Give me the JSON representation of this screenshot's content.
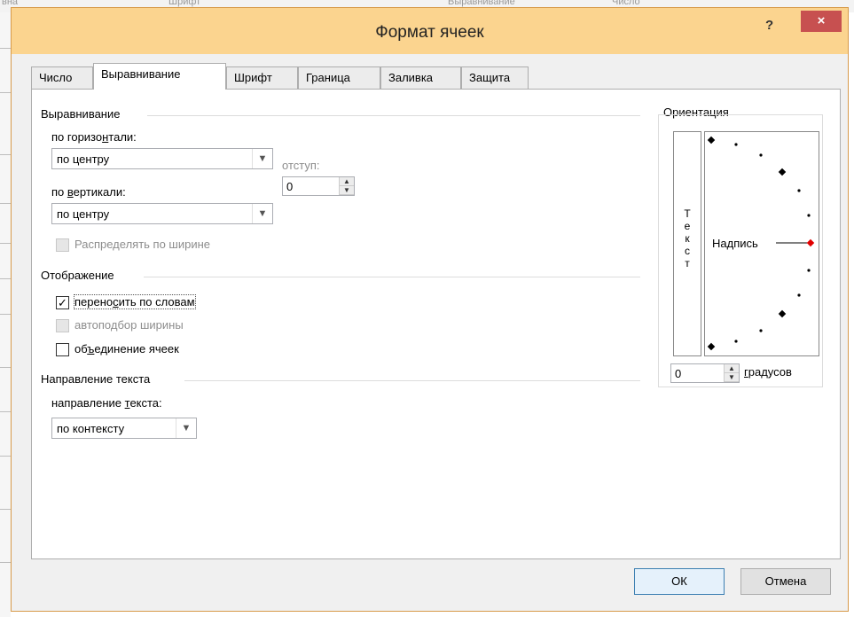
{
  "dialog": {
    "title": "Формат ячеек",
    "help_label": "?",
    "close_label": "×"
  },
  "tabs": [
    {
      "label": "Число"
    },
    {
      "label": "Выравнивание",
      "active": true
    },
    {
      "label": "Шрифт"
    },
    {
      "label": "Граница"
    },
    {
      "label": "Заливка"
    },
    {
      "label": "Защита"
    }
  ],
  "alignment": {
    "section_title": "Выравнивание",
    "horizontal_label_pre": "по горизо",
    "horizontal_label_accel": "н",
    "horizontal_label_post": "тали:",
    "horizontal_value": "по центру",
    "indent_label": "отступ:",
    "indent_value": "0",
    "vertical_label_pre": "по ",
    "vertical_label_accel": "в",
    "vertical_label_post": "ертикали:",
    "vertical_value": "по центру",
    "distribute_label": "Распределять по ширине",
    "distribute_checked": false,
    "distribute_enabled": false
  },
  "display": {
    "section_title": "Отображение",
    "wrap_label_pre": "перено",
    "wrap_label_accel": "с",
    "wrap_label_post": "ить по словам",
    "wrap_checked": true,
    "shrink_label": "автоподбор ширины",
    "shrink_checked": false,
    "shrink_enabled": false,
    "merge_label_pre": "об",
    "merge_label_accel": "ъ",
    "merge_label_post": "единение ячеек",
    "merge_checked": false
  },
  "text_direction": {
    "section_title": "Направление текста",
    "label_pre": "направление ",
    "label_accel": "т",
    "label_post": "екста:",
    "value": "по контексту"
  },
  "orientation": {
    "section_title": "Ориентация",
    "vertical_text": [
      "Т",
      "е",
      "к",
      "с",
      "т"
    ],
    "dial_label": "Надпись",
    "degrees_value": "0",
    "degrees_label_accel": "г",
    "degrees_label_post": "радусов",
    "angle_degrees": 0,
    "marker_color": "#e00000"
  },
  "buttons": {
    "ok_label": "ОК",
    "cancel_label": "Отмена"
  },
  "background_strip": [
    "вна",
    "Шрифт",
    "Выравнивание",
    "Число"
  ]
}
